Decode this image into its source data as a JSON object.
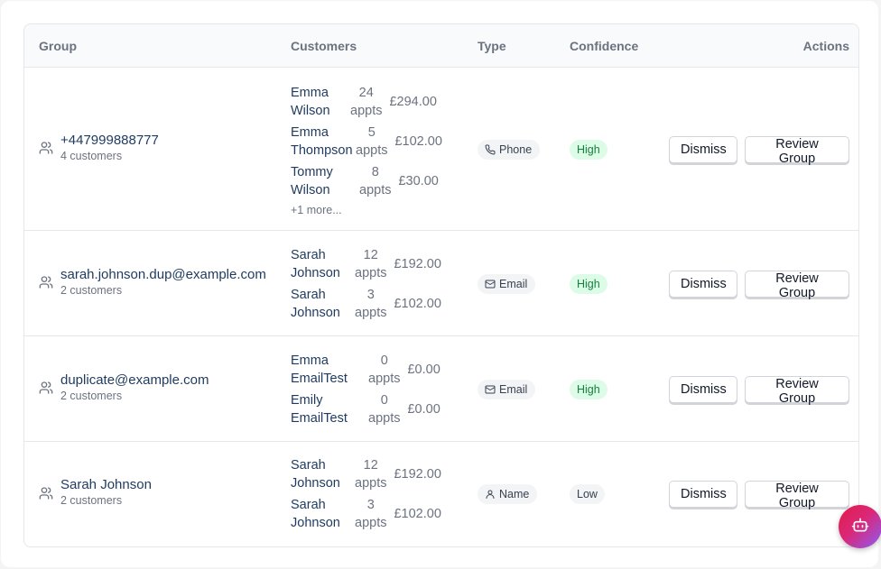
{
  "headers": {
    "group": "Group",
    "customers": "Customers",
    "type": "Type",
    "confidence": "Confidence",
    "actions": "Actions"
  },
  "rows": [
    {
      "group_name": "+447999888777",
      "group_count": "4 customers",
      "customers": [
        {
          "first": "Emma",
          "last": "Wilson",
          "appts_num": "24",
          "appts_label": "appts",
          "amount": "£294.00"
        },
        {
          "first": "Emma",
          "last": "Thompson",
          "appts_num": "5",
          "appts_label": "appts",
          "amount": "£102.00"
        },
        {
          "first": "Tommy",
          "last": "Wilson",
          "appts_num": "8",
          "appts_label": "appts",
          "amount": "£30.00"
        }
      ],
      "more": "+1 more...",
      "type": "Phone",
      "type_icon": "phone-icon",
      "confidence": "High",
      "dismiss": "Dismiss",
      "review": "Review Group"
    },
    {
      "group_name": "sarah.johnson.dup@example.com",
      "group_count": "2 customers",
      "customers": [
        {
          "first": "Sarah",
          "last": "Johnson",
          "appts_num": "12",
          "appts_label": "appts",
          "amount": "£192.00"
        },
        {
          "first": "Sarah",
          "last": "Johnson",
          "appts_num": "3",
          "appts_label": "appts",
          "amount": "£102.00"
        }
      ],
      "type": "Email",
      "type_icon": "mail-icon",
      "confidence": "High",
      "dismiss": "Dismiss",
      "review": "Review Group"
    },
    {
      "group_name": "duplicate@example.com",
      "group_count": "2 customers",
      "customers": [
        {
          "first": "Emma",
          "last": "EmailTest",
          "appts_num": "0",
          "appts_label": "appts",
          "amount": "£0.00"
        },
        {
          "first": "Emily",
          "last": "EmailTest",
          "appts_num": "0",
          "appts_label": "appts",
          "amount": "£0.00"
        }
      ],
      "type": "Email",
      "type_icon": "mail-icon",
      "confidence": "High",
      "dismiss": "Dismiss",
      "review": "Review Group"
    },
    {
      "group_name": "Sarah Johnson",
      "group_count": "2 customers",
      "customers": [
        {
          "first": "Sarah",
          "last": "Johnson",
          "appts_num": "12",
          "appts_label": "appts",
          "amount": "£192.00"
        },
        {
          "first": "Sarah",
          "last": "Johnson",
          "appts_num": "3",
          "appts_label": "appts",
          "amount": "£102.00"
        }
      ],
      "type": "Name",
      "type_icon": "user-icon",
      "confidence": "Low",
      "dismiss": "Dismiss",
      "review": "Review Group"
    }
  ],
  "colors": {
    "high_bg": "#dcfce7",
    "high_text": "#15803d",
    "link": "#1e3a5f",
    "fab_gradient": [
      "#e11d48",
      "#db2777",
      "#8b5cf6"
    ]
  },
  "fab_icon": "bot-icon"
}
